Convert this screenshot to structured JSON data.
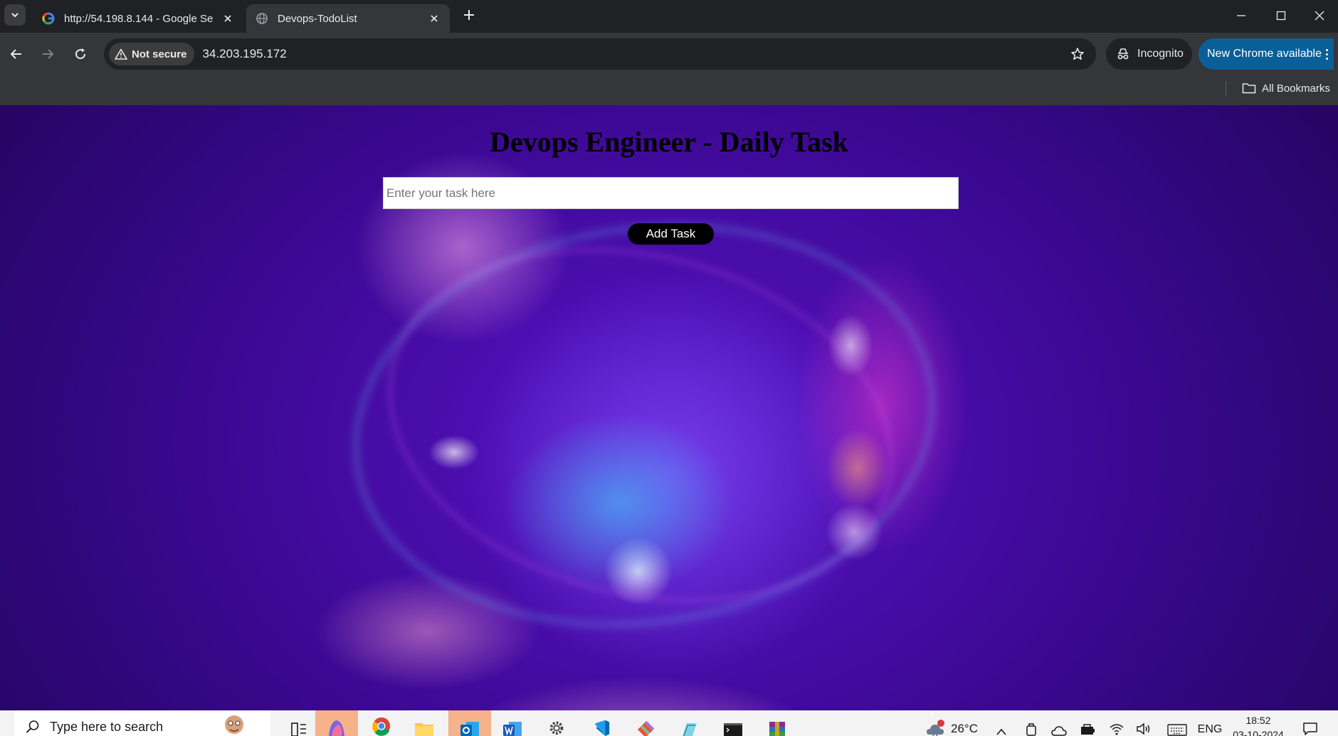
{
  "browser": {
    "tabs": [
      {
        "title": "http://54.198.8.144 - Google Se",
        "favicon": "google-icon",
        "active": false
      },
      {
        "title": "Devops-TodoList",
        "favicon": "globe-icon",
        "active": true
      }
    ],
    "security_label": "Not secure",
    "url": "34.203.195.172",
    "incognito_label": "Incognito",
    "update_label": "New Chrome available",
    "bookmarks_label": "All Bookmarks"
  },
  "page": {
    "title": "Devops Engineer - Daily Task",
    "task_input": {
      "placeholder": "Enter your task here",
      "value": ""
    },
    "add_button_label": "Add Task"
  },
  "taskbar": {
    "search_placeholder": "Type here to search",
    "apps": [
      "copilot-icon",
      "chrome-icon",
      "file-explorer-icon",
      "outlook-icon",
      "word-icon",
      "settings-icon",
      "vscode-icon",
      "git-icon",
      "notepad-icon",
      "terminal-icon",
      "winrar-icon"
    ],
    "weather": {
      "temperature": "26°C",
      "alert_count": "1"
    },
    "language": "ENG",
    "time": "18:52",
    "date": "03-10-2024"
  },
  "colors": {
    "chrome_frame": "#202124",
    "chrome_toolbar": "#35363a",
    "update_button": "#0b5f98",
    "page_bg_purple": "#4a0cb0",
    "add_button": "#000000"
  }
}
